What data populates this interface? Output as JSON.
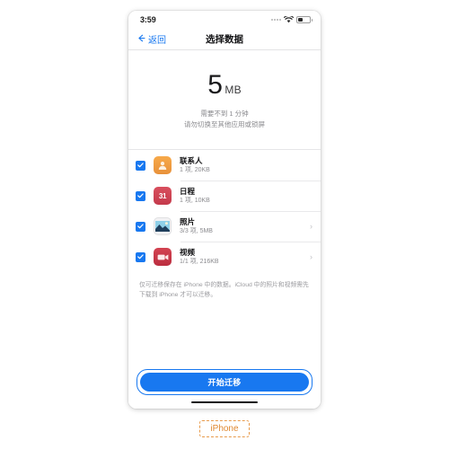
{
  "colors": {
    "accent": "#1878f0",
    "caption": "#e08a33",
    "contacts_icon": "#f0993f",
    "calendar_icon": "#cc4050",
    "video_icon": "#c73546",
    "muted_text": "#8a8a8e"
  },
  "statusbar": {
    "time": "3:59",
    "signal_icon": "signal-dots-icon",
    "wifi_icon": "wifi-icon",
    "battery_icon": "battery-icon"
  },
  "navbar": {
    "back_icon": "back-arrow-icon",
    "back_label": "返回",
    "title": "选择数据"
  },
  "hero": {
    "size_value": "5",
    "size_unit": "MB",
    "subtitle_line1": "需要不到 1 分钟",
    "subtitle_line2": "请勿切换至其他应用或锁屏"
  },
  "list": [
    {
      "icon": "contacts-icon",
      "icon_glyph": "",
      "title": "联系人",
      "meta": "1 项, 20KB",
      "checked": true,
      "has_chevron": false
    },
    {
      "icon": "calendar-icon",
      "icon_glyph": "31",
      "title": "日程",
      "meta": "1 项, 10KB",
      "checked": true,
      "has_chevron": false
    },
    {
      "icon": "photos-icon",
      "icon_glyph": "",
      "title": "照片",
      "meta": "3/3 项, 5MB",
      "checked": true,
      "has_chevron": true,
      "chevron_glyph": "›"
    },
    {
      "icon": "video-icon",
      "icon_glyph": "",
      "title": "视频",
      "meta": "1/1 项, 216KB",
      "checked": true,
      "has_chevron": true,
      "chevron_glyph": "›"
    }
  ],
  "footnote": "仅可迁移保存在 iPhone 中的数据。iCloud 中的照片和视频需先下载到 iPhone 才可以迁移。",
  "bottom": {
    "cta_label": "开始迁移",
    "home_indicator": "home-indicator"
  },
  "caption": {
    "device_label": "iPhone"
  }
}
